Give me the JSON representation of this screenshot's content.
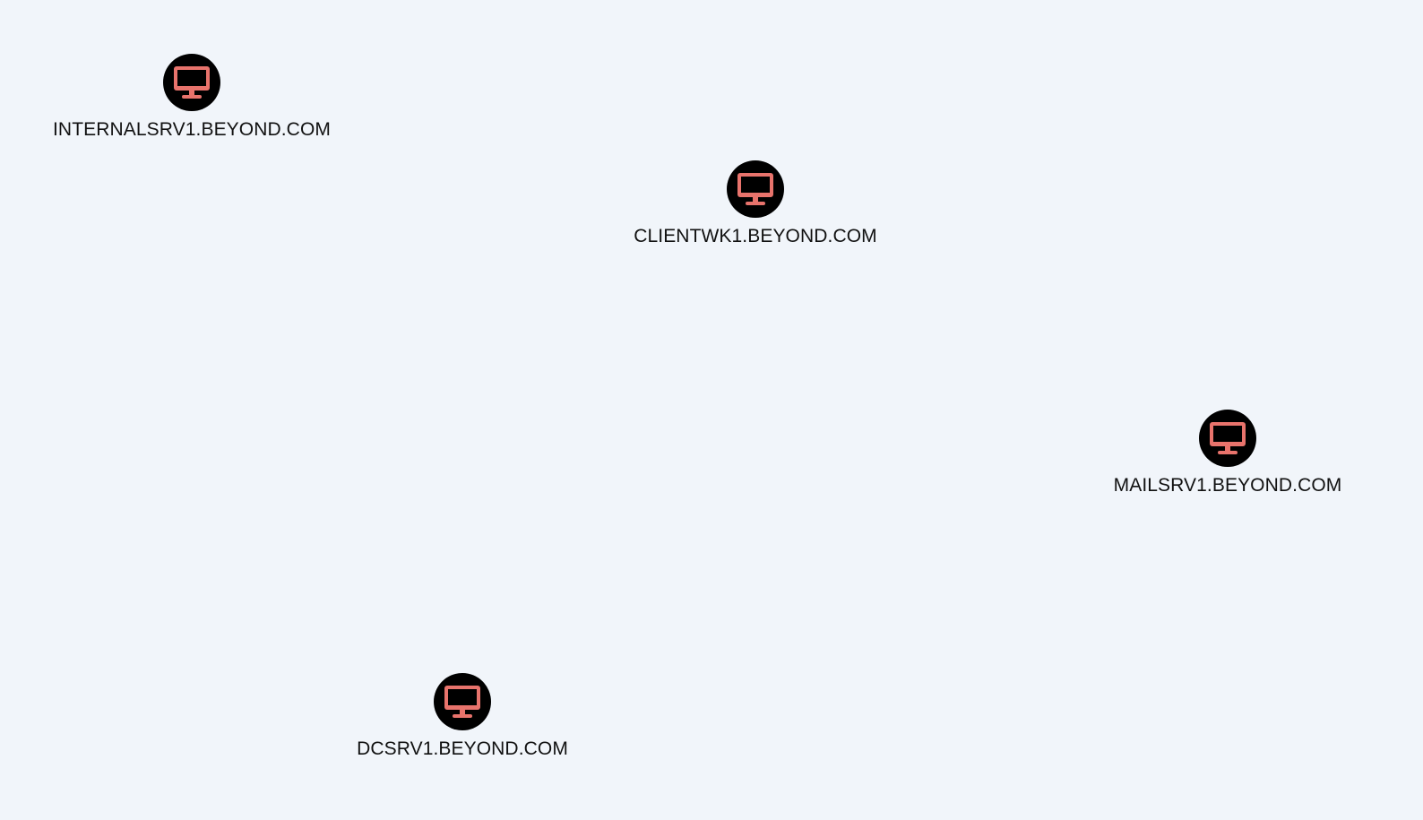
{
  "graph": {
    "nodes": [
      {
        "label": "INTERNALSRV1.BEYOND.COM",
        "type": "computer",
        "icon": "monitor-icon"
      },
      {
        "label": "CLIENTWK1.BEYOND.COM",
        "type": "computer",
        "icon": "monitor-icon"
      },
      {
        "label": "MAILSRV1.BEYOND.COM",
        "type": "computer",
        "icon": "monitor-icon"
      },
      {
        "label": "DCSRV1.BEYOND.COM",
        "type": "computer",
        "icon": "monitor-icon"
      }
    ]
  },
  "colors": {
    "background": "#f1f5fa",
    "node_fill": "#000000",
    "icon_color": "#e8736c",
    "label_color": "#111111"
  }
}
